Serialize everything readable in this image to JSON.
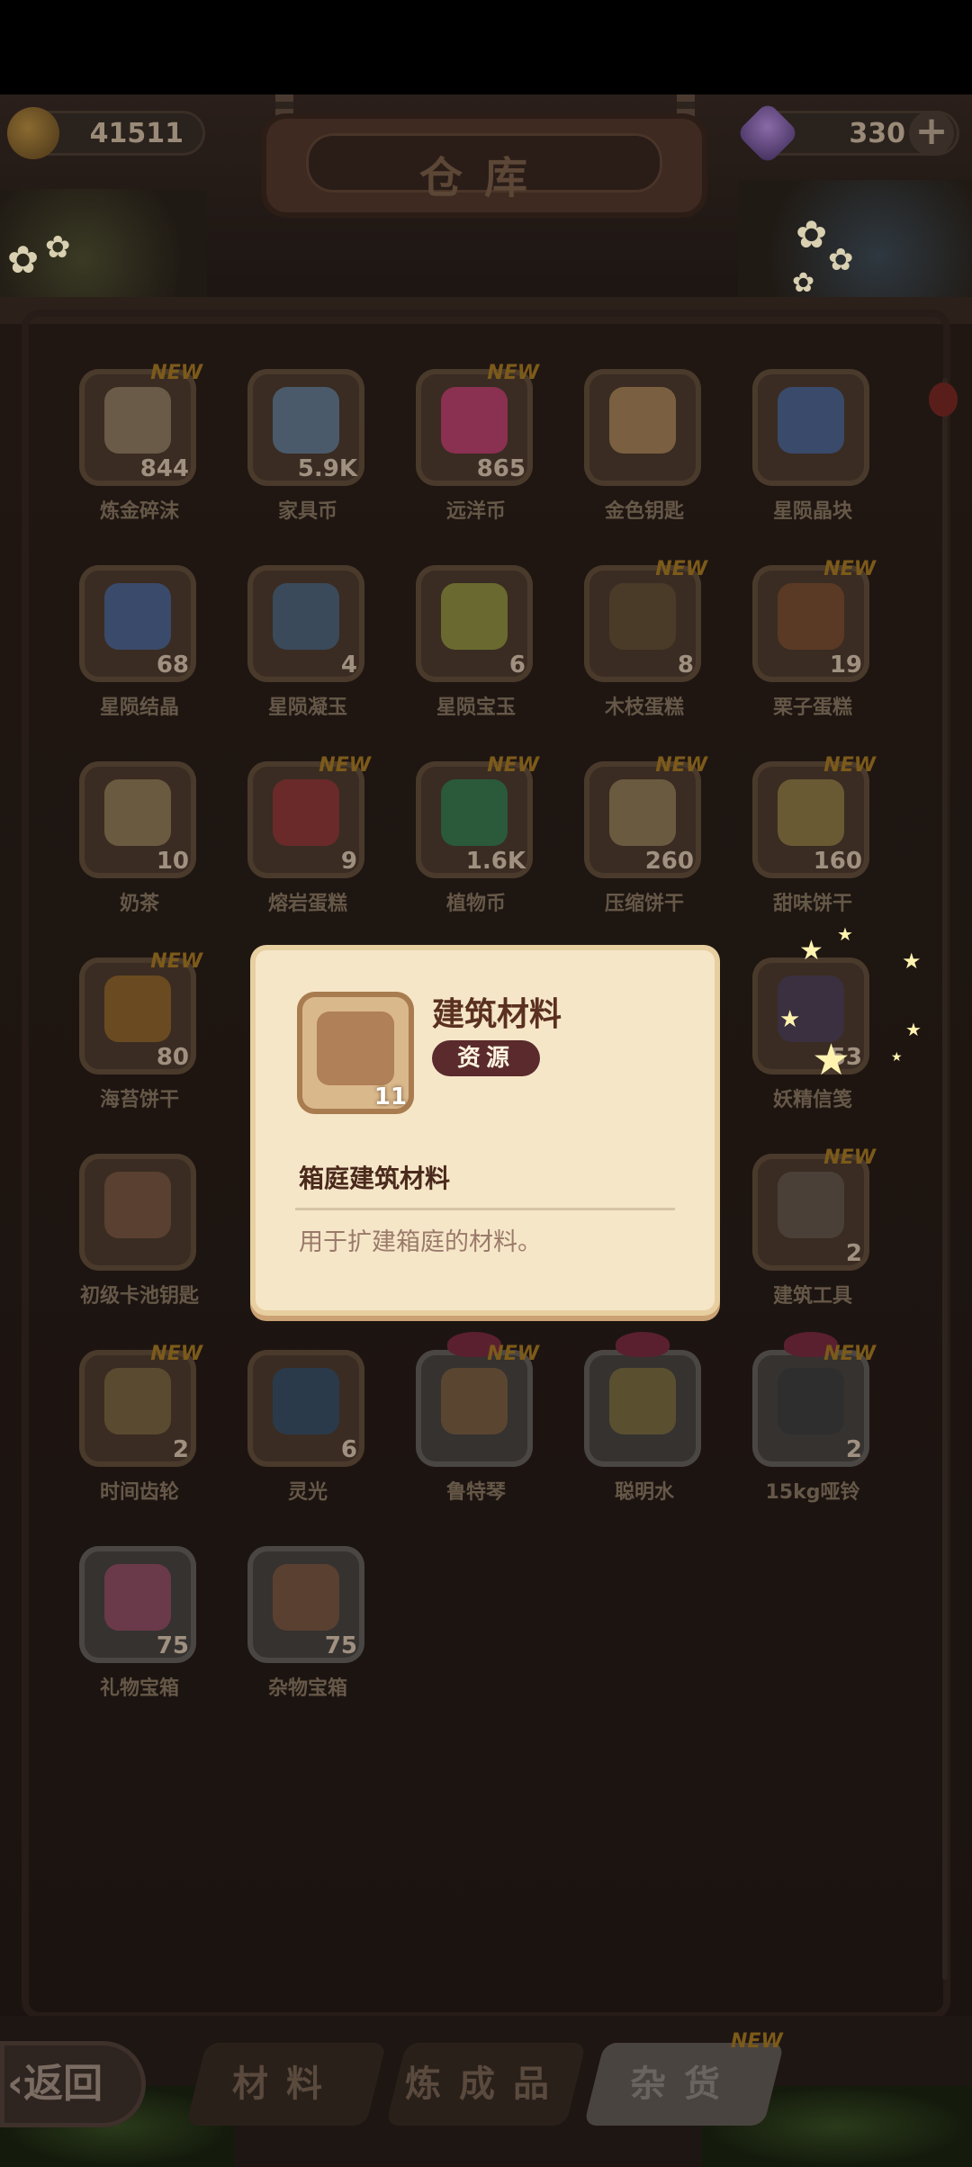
{
  "header": {
    "title": "仓库",
    "coins": "41511",
    "gems": "330",
    "add_label": "+"
  },
  "items": [
    {
      "name": "炼金碎沫",
      "count": "844",
      "new": "NEW",
      "color": "#6a5a48"
    },
    {
      "name": "家具币",
      "count": "5.9K",
      "new": "",
      "color": "#4a5a6a"
    },
    {
      "name": "远洋币",
      "count": "865",
      "new": "NEW",
      "color": "#8a3050"
    },
    {
      "name": "金色钥匙",
      "count": "",
      "new": "",
      "color": "#7a6040"
    },
    {
      "name": "星陨晶块",
      "count": "",
      "new": "",
      "color": "#3a4a6a"
    },
    {
      "name": "星陨结晶",
      "count": "68",
      "new": "",
      "color": "#3a4a6a"
    },
    {
      "name": "星陨凝玉",
      "count": "4",
      "new": "",
      "color": "#3a4a5a"
    },
    {
      "name": "星陨宝玉",
      "count": "6",
      "new": "",
      "color": "#6a6a30"
    },
    {
      "name": "木枝蛋糕",
      "count": "8",
      "new": "NEW",
      "color": "#4a3a28"
    },
    {
      "name": "栗子蛋糕",
      "count": "19",
      "new": "NEW",
      "color": "#5a3a24"
    },
    {
      "name": "奶茶",
      "count": "10",
      "new": "",
      "color": "#6a5a40"
    },
    {
      "name": "熔岩蛋糕",
      "count": "9",
      "new": "NEW",
      "color": "#6a2a2a"
    },
    {
      "name": "植物币",
      "count": "1.6K",
      "new": "NEW",
      "color": "#2a5a3a"
    },
    {
      "name": "压缩饼干",
      "count": "260",
      "new": "NEW",
      "color": "#6a5a40"
    },
    {
      "name": "甜味饼干",
      "count": "160",
      "new": "NEW",
      "color": "#6a5a34"
    },
    {
      "name": "海苔饼干",
      "count": "80",
      "new": "NEW",
      "color": "#6a4a20"
    },
    {
      "name": "",
      "count": "",
      "new": "",
      "color": "#3a2c22"
    },
    {
      "name": "",
      "count": "",
      "new": "",
      "color": "#3a2c22"
    },
    {
      "name": "",
      "count": "",
      "new": "",
      "color": "#3a2c22"
    },
    {
      "name": "妖精信笺",
      "count": "53",
      "new": "",
      "color": "#3a3040"
    },
    {
      "name": "初级卡池钥匙",
      "count": "",
      "new": "",
      "color": "#5a4030"
    },
    {
      "name": "",
      "count": "",
      "new": "",
      "color": "#3a2c22"
    },
    {
      "name": "",
      "count": "",
      "new": "",
      "color": "#3a2c22"
    },
    {
      "name": "",
      "count": "",
      "new": "",
      "color": "#3a2c22"
    },
    {
      "name": "建筑工具",
      "count": "2",
      "new": "NEW",
      "color": "#4a4038"
    },
    {
      "name": "时间齿轮",
      "count": "2",
      "new": "NEW",
      "color": "#5a4a30"
    },
    {
      "name": "灵光",
      "count": "6",
      "new": "",
      "color": "#2a3a4a"
    },
    {
      "name": "鲁特琴",
      "count": "",
      "new": "NEW",
      "color": "#5a4630"
    },
    {
      "name": "聪明水",
      "count": "",
      "new": "",
      "color": "#5a5030"
    },
    {
      "name": "15kg哑铃",
      "count": "2",
      "new": "NEW",
      "color": "#2e2e2e"
    },
    {
      "name": "礼物宝箱",
      "count": "75",
      "new": "",
      "color": "#6a3a4a"
    },
    {
      "name": "杂物宝箱",
      "count": "75",
      "new": "",
      "color": "#5a4030"
    }
  ],
  "popup": {
    "title": "建筑材料",
    "tag": "资源",
    "count": "11",
    "subtitle": "箱庭建筑材料",
    "description": "用于扩建箱庭的材料。"
  },
  "bottom": {
    "back_label": "‹返回",
    "tabs": [
      "材料",
      "炼成品",
      "杂货"
    ],
    "tab_new": "NEW"
  }
}
